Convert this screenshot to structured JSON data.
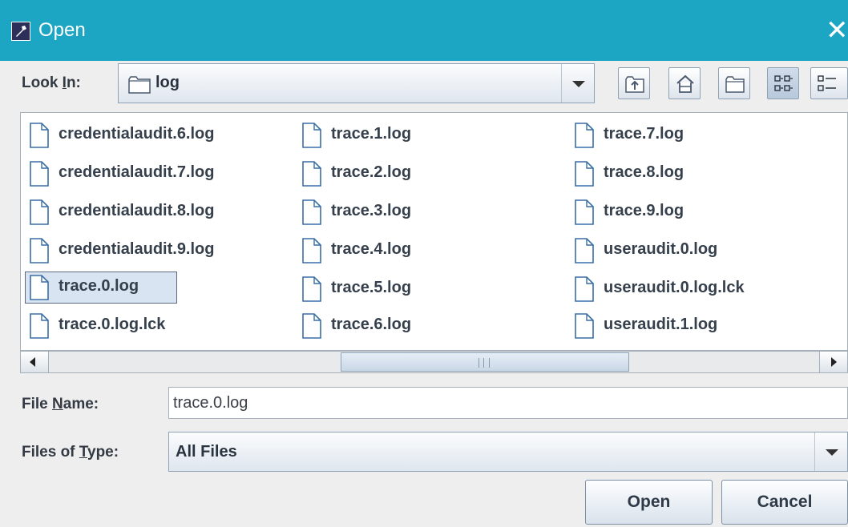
{
  "window": {
    "title": "Open",
    "close_glyph": "✕"
  },
  "look_in": {
    "label_prefix": "Look ",
    "label_mnemonic": "I",
    "label_suffix": "n:",
    "value": "log"
  },
  "toolbar": {
    "up_one_level": "up-folder-icon",
    "home": "home-icon",
    "new_folder": "new-folder-icon",
    "list_view": "list-view-icon",
    "details_view": "details-view-icon"
  },
  "files": [
    "credentialaudit.6.log",
    "credentialaudit.7.log",
    "credentialaudit.8.log",
    "credentialaudit.9.log",
    "trace.0.log",
    "trace.0.log.lck",
    "trace.1.log",
    "trace.2.log",
    "trace.3.log",
    "trace.4.log",
    "trace.5.log",
    "trace.6.log",
    "trace.7.log",
    "trace.8.log",
    "trace.9.log",
    "useraudit.0.log",
    "useraudit.0.log.lck",
    "useraudit.1.log"
  ],
  "selected_file": "trace.0.log",
  "file_name": {
    "label_prefix": "File ",
    "label_mnemonic": "N",
    "label_suffix": "ame:",
    "value": "trace.0.log"
  },
  "files_of_type": {
    "label_prefix": "Files of ",
    "label_mnemonic": "T",
    "label_suffix": "ype:",
    "value": "All Files"
  },
  "buttons": {
    "open": "Open",
    "cancel": "Cancel"
  },
  "colors": {
    "titlebar": "#1da6c4",
    "selection": "#d8e4f1"
  }
}
